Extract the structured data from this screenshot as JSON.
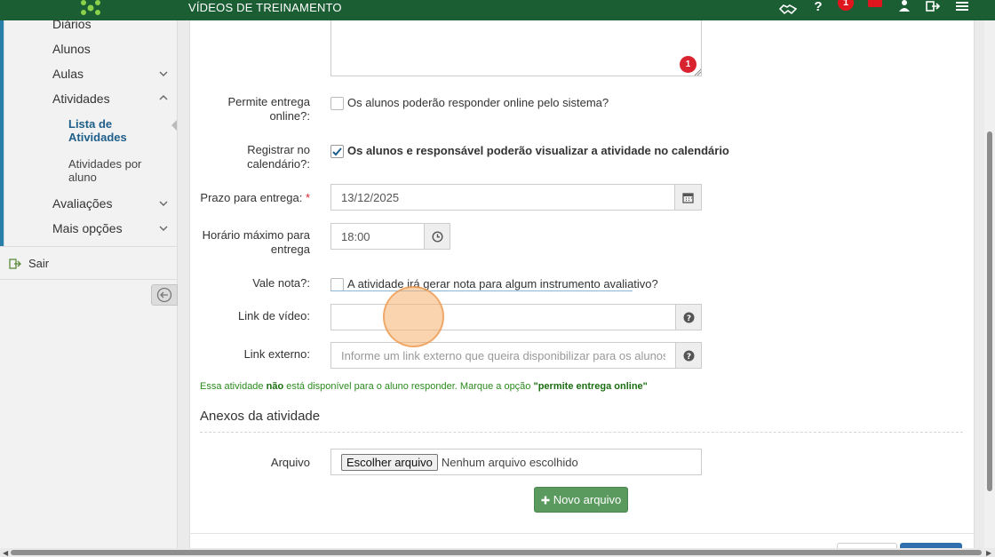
{
  "topbar": {
    "title": "VÍDEOS DE TREINAMENTO",
    "notification_count": "1",
    "icons": [
      "handshake-icon",
      "help-icon",
      "notification-badge",
      "mail-icon",
      "user-icon",
      "logout-icon",
      "menu-icon"
    ]
  },
  "sidebar": {
    "items": [
      {
        "label": "Diários"
      },
      {
        "label": "Alunos"
      },
      {
        "label": "Aulas"
      },
      {
        "label": "Atividades"
      },
      {
        "label": "Avaliações"
      },
      {
        "label": "Mais opções"
      }
    ],
    "sub_items": [
      {
        "label": "Lista de Atividades",
        "active": true
      },
      {
        "label": "Atividades por aluno",
        "active": false
      }
    ],
    "logout": "Sair"
  },
  "form": {
    "textarea_badge": "1",
    "permite_entrega": {
      "label": "Permite entrega online?:",
      "text": "Os alunos poderão responder online pelo sistema?",
      "checked": false
    },
    "registrar_calendario": {
      "label": "Registrar no calendário?:",
      "text": "Os alunos e responsável poderão visualizar a atividade no calendário",
      "checked": true
    },
    "prazo": {
      "label": "Prazo para entrega:",
      "required_mark": "*",
      "value": "13/12/2025"
    },
    "horario": {
      "label": "Horário máximo para entrega",
      "value": "18:00"
    },
    "vale_nota": {
      "label": "Vale nota?:",
      "text": "A atividade irá gerar nota para algum instrumento avaliativo?",
      "checked": false
    },
    "link_video": {
      "label": "Link de vídeo:",
      "value": "",
      "placeholder": ""
    },
    "link_externo": {
      "label": "Link externo:",
      "value": "",
      "placeholder": "Informe um link externo que queira disponibilizar para os alunos"
    },
    "notice": {
      "prefix": "Essa atividade ",
      "emphasis": "não",
      "middle": " está disponível para o aluno responder. Marque a opção ",
      "option": "\"permite entrega online\""
    }
  },
  "attachments": {
    "title": "Anexos da atividade",
    "file_label": "Arquivo",
    "choose_button": "Escolher arquivo",
    "no_file": "Nenhum arquivo escolhido",
    "new_file_button": "Novo arquivo"
  },
  "colors": {
    "topbar": "#1b5e33",
    "accent_blue": "#1e5e8a",
    "badge_red": "#e0161f",
    "notice_green": "#2b8a1e",
    "button_green": "#5a9a5f"
  }
}
